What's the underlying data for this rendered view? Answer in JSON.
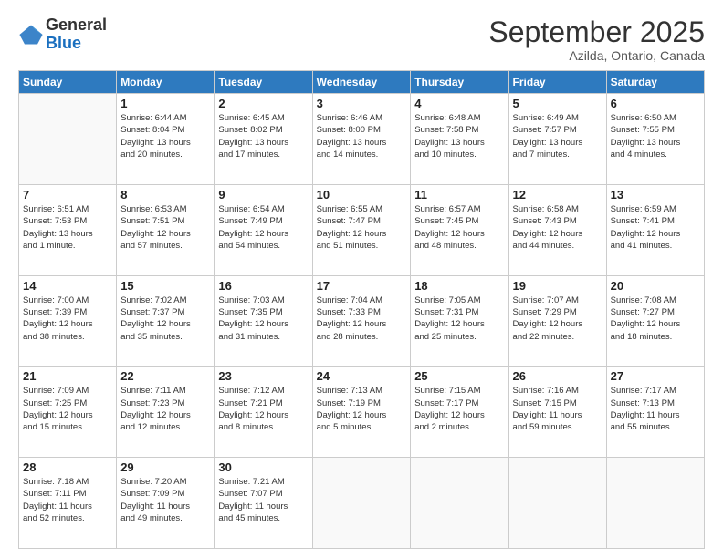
{
  "logo": {
    "general": "General",
    "blue": "Blue"
  },
  "header": {
    "month": "September 2025",
    "location": "Azilda, Ontario, Canada"
  },
  "weekdays": [
    "Sunday",
    "Monday",
    "Tuesday",
    "Wednesday",
    "Thursday",
    "Friday",
    "Saturday"
  ],
  "weeks": [
    [
      {
        "day": "",
        "info": ""
      },
      {
        "day": "1",
        "info": "Sunrise: 6:44 AM\nSunset: 8:04 PM\nDaylight: 13 hours\nand 20 minutes."
      },
      {
        "day": "2",
        "info": "Sunrise: 6:45 AM\nSunset: 8:02 PM\nDaylight: 13 hours\nand 17 minutes."
      },
      {
        "day": "3",
        "info": "Sunrise: 6:46 AM\nSunset: 8:00 PM\nDaylight: 13 hours\nand 14 minutes."
      },
      {
        "day": "4",
        "info": "Sunrise: 6:48 AM\nSunset: 7:58 PM\nDaylight: 13 hours\nand 10 minutes."
      },
      {
        "day": "5",
        "info": "Sunrise: 6:49 AM\nSunset: 7:57 PM\nDaylight: 13 hours\nand 7 minutes."
      },
      {
        "day": "6",
        "info": "Sunrise: 6:50 AM\nSunset: 7:55 PM\nDaylight: 13 hours\nand 4 minutes."
      }
    ],
    [
      {
        "day": "7",
        "info": "Sunrise: 6:51 AM\nSunset: 7:53 PM\nDaylight: 13 hours\nand 1 minute."
      },
      {
        "day": "8",
        "info": "Sunrise: 6:53 AM\nSunset: 7:51 PM\nDaylight: 12 hours\nand 57 minutes."
      },
      {
        "day": "9",
        "info": "Sunrise: 6:54 AM\nSunset: 7:49 PM\nDaylight: 12 hours\nand 54 minutes."
      },
      {
        "day": "10",
        "info": "Sunrise: 6:55 AM\nSunset: 7:47 PM\nDaylight: 12 hours\nand 51 minutes."
      },
      {
        "day": "11",
        "info": "Sunrise: 6:57 AM\nSunset: 7:45 PM\nDaylight: 12 hours\nand 48 minutes."
      },
      {
        "day": "12",
        "info": "Sunrise: 6:58 AM\nSunset: 7:43 PM\nDaylight: 12 hours\nand 44 minutes."
      },
      {
        "day": "13",
        "info": "Sunrise: 6:59 AM\nSunset: 7:41 PM\nDaylight: 12 hours\nand 41 minutes."
      }
    ],
    [
      {
        "day": "14",
        "info": "Sunrise: 7:00 AM\nSunset: 7:39 PM\nDaylight: 12 hours\nand 38 minutes."
      },
      {
        "day": "15",
        "info": "Sunrise: 7:02 AM\nSunset: 7:37 PM\nDaylight: 12 hours\nand 35 minutes."
      },
      {
        "day": "16",
        "info": "Sunrise: 7:03 AM\nSunset: 7:35 PM\nDaylight: 12 hours\nand 31 minutes."
      },
      {
        "day": "17",
        "info": "Sunrise: 7:04 AM\nSunset: 7:33 PM\nDaylight: 12 hours\nand 28 minutes."
      },
      {
        "day": "18",
        "info": "Sunrise: 7:05 AM\nSunset: 7:31 PM\nDaylight: 12 hours\nand 25 minutes."
      },
      {
        "day": "19",
        "info": "Sunrise: 7:07 AM\nSunset: 7:29 PM\nDaylight: 12 hours\nand 22 minutes."
      },
      {
        "day": "20",
        "info": "Sunrise: 7:08 AM\nSunset: 7:27 PM\nDaylight: 12 hours\nand 18 minutes."
      }
    ],
    [
      {
        "day": "21",
        "info": "Sunrise: 7:09 AM\nSunset: 7:25 PM\nDaylight: 12 hours\nand 15 minutes."
      },
      {
        "day": "22",
        "info": "Sunrise: 7:11 AM\nSunset: 7:23 PM\nDaylight: 12 hours\nand 12 minutes."
      },
      {
        "day": "23",
        "info": "Sunrise: 7:12 AM\nSunset: 7:21 PM\nDaylight: 12 hours\nand 8 minutes."
      },
      {
        "day": "24",
        "info": "Sunrise: 7:13 AM\nSunset: 7:19 PM\nDaylight: 12 hours\nand 5 minutes."
      },
      {
        "day": "25",
        "info": "Sunrise: 7:15 AM\nSunset: 7:17 PM\nDaylight: 12 hours\nand 2 minutes."
      },
      {
        "day": "26",
        "info": "Sunrise: 7:16 AM\nSunset: 7:15 PM\nDaylight: 11 hours\nand 59 minutes."
      },
      {
        "day": "27",
        "info": "Sunrise: 7:17 AM\nSunset: 7:13 PM\nDaylight: 11 hours\nand 55 minutes."
      }
    ],
    [
      {
        "day": "28",
        "info": "Sunrise: 7:18 AM\nSunset: 7:11 PM\nDaylight: 11 hours\nand 52 minutes."
      },
      {
        "day": "29",
        "info": "Sunrise: 7:20 AM\nSunset: 7:09 PM\nDaylight: 11 hours\nand 49 minutes."
      },
      {
        "day": "30",
        "info": "Sunrise: 7:21 AM\nSunset: 7:07 PM\nDaylight: 11 hours\nand 45 minutes."
      },
      {
        "day": "",
        "info": ""
      },
      {
        "day": "",
        "info": ""
      },
      {
        "day": "",
        "info": ""
      },
      {
        "day": "",
        "info": ""
      }
    ]
  ]
}
